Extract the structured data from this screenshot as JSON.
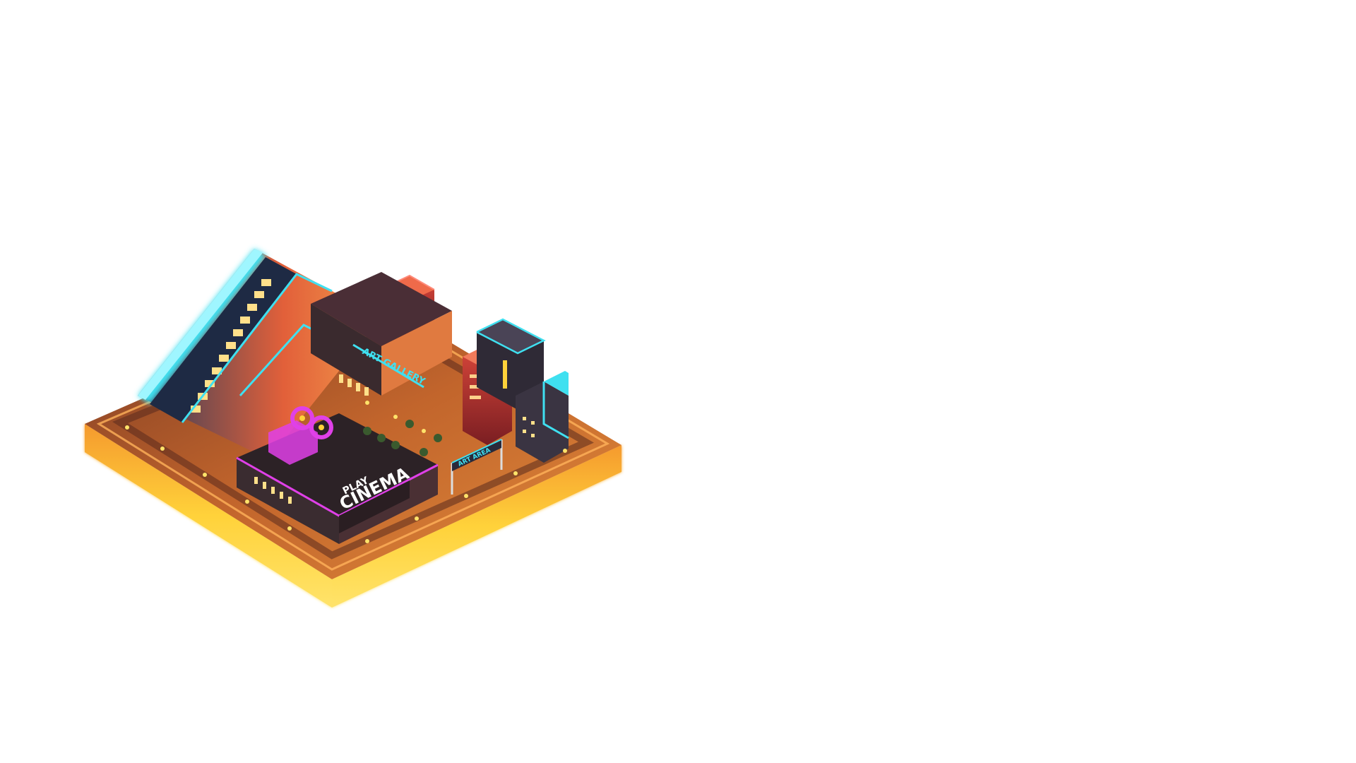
{
  "scene": {
    "description_kind": "isometric neon city diorama render",
    "background_color": "#ffffff",
    "signs": {
      "art_gallery": "ART GALLERY",
      "play": "PLAY",
      "cinema": "CINEMA",
      "art_area": "ART AREA"
    },
    "colors": {
      "neon_cyan": "#3fe0f0",
      "neon_magenta": "#e040e8",
      "base_glow": "#ffd23a",
      "base_orange": "#f08a2a",
      "building_red": "#c8382a",
      "building_dark": "#3a2a2e",
      "window_warm": "#ffe08a"
    }
  }
}
